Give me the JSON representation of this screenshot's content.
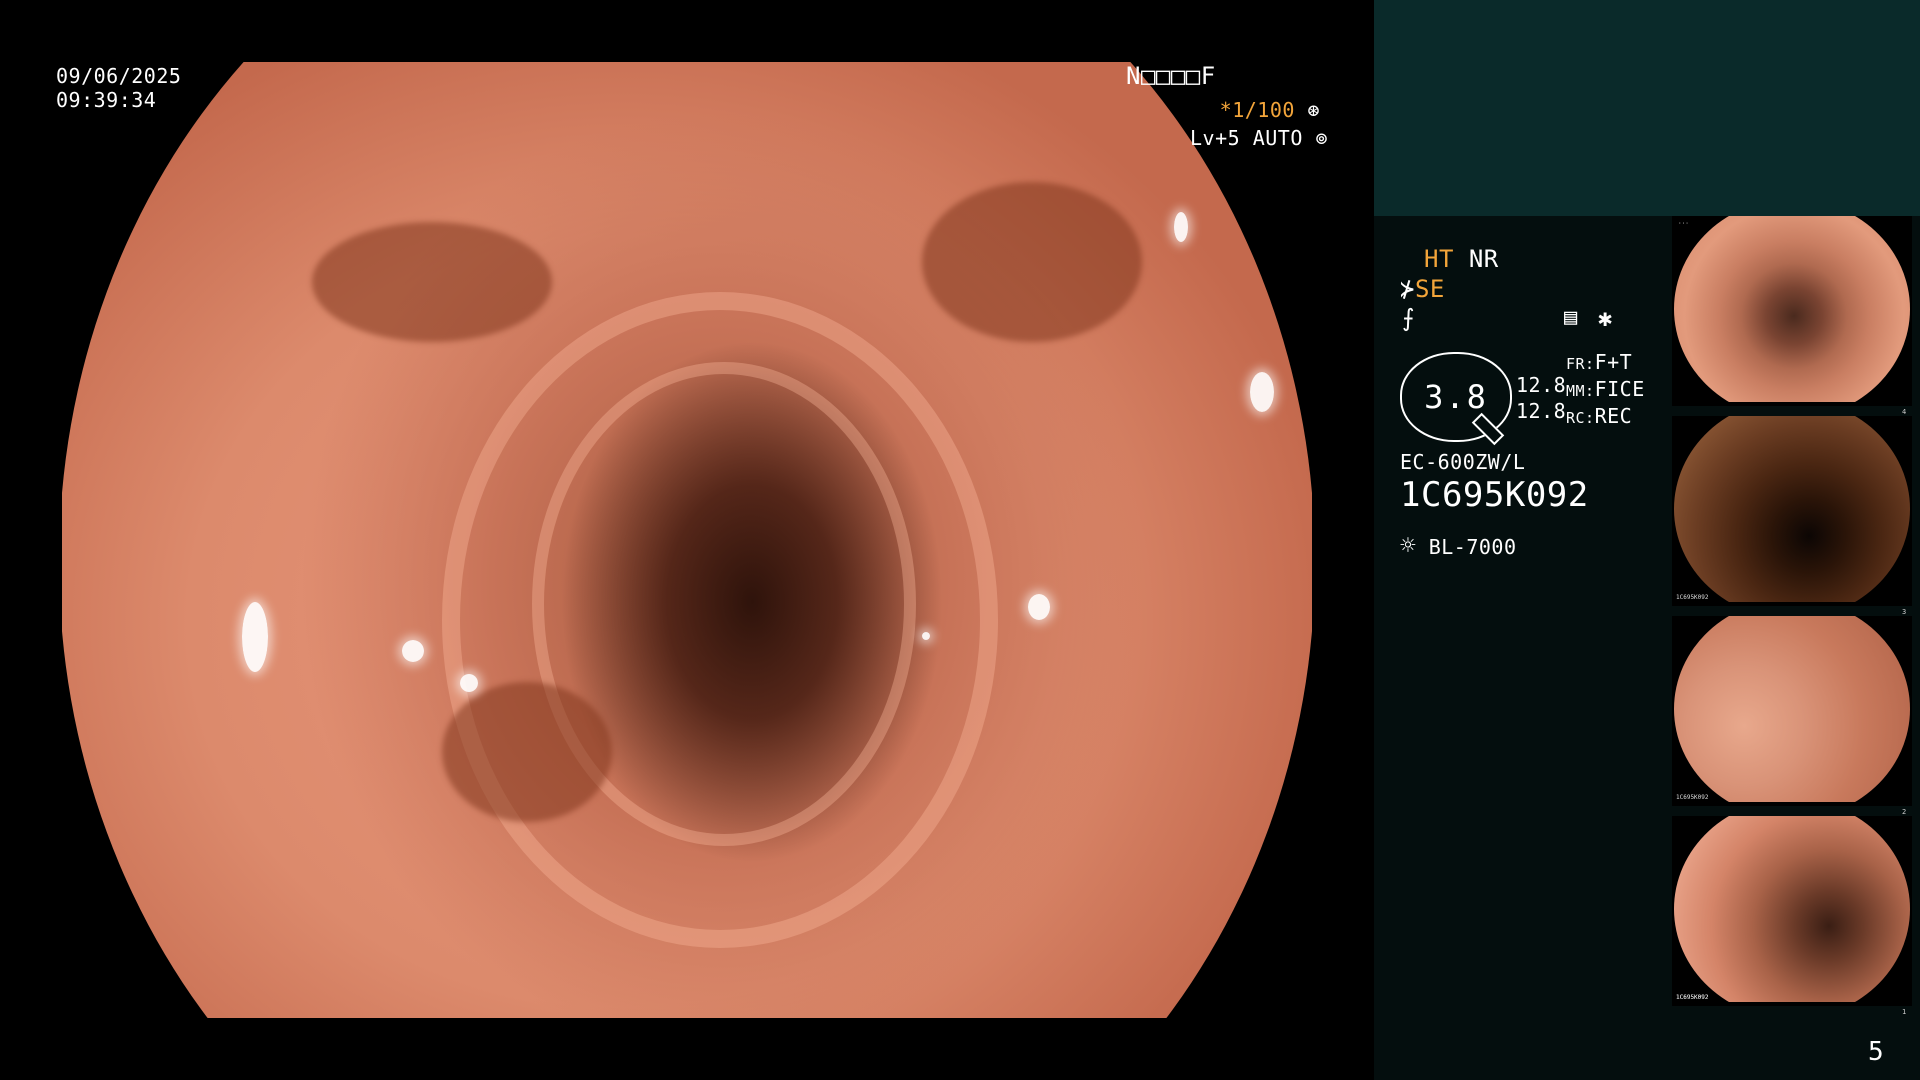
{
  "overlay": {
    "date": "09/06/2025",
    "time": "09:39:34",
    "patient_code": "N□□□□F",
    "shutter": "*1/100",
    "level": "Lv+5",
    "iris_mode": "AUTO"
  },
  "settings": {
    "ht": "HT",
    "nr": "NR",
    "se": "SE",
    "magnification": "3.8",
    "val1": "12.8",
    "val2": "12.8",
    "fr_label": "FR:",
    "fr_value": "F+T",
    "mm_label": "MM:",
    "mm_value": "FICE",
    "rc_label": "RC:",
    "rc_value": "REC",
    "scope_model": "EC-600ZW/L",
    "serial": "1C695K092",
    "light_source": "BL-7000"
  },
  "thumbnails": [
    {
      "label": "1C695K092",
      "index": "4"
    },
    {
      "label": "1C695K092",
      "index": "3"
    },
    {
      "label": "1C695K092",
      "index": "2"
    },
    {
      "label": "1C695K092",
      "index": "1"
    }
  ],
  "image_count": "5",
  "icons": {
    "shutter": "aperture-icon",
    "iris": "iris-icon",
    "light": "sun-icon",
    "structure": "structure-icon",
    "af": "af-icon",
    "memo": "memo-icon",
    "star": "asterisk-icon"
  },
  "colors": {
    "accent": "#f3a53a",
    "panel_top": "#0a2a2a",
    "panel_info": "#040e0e"
  }
}
